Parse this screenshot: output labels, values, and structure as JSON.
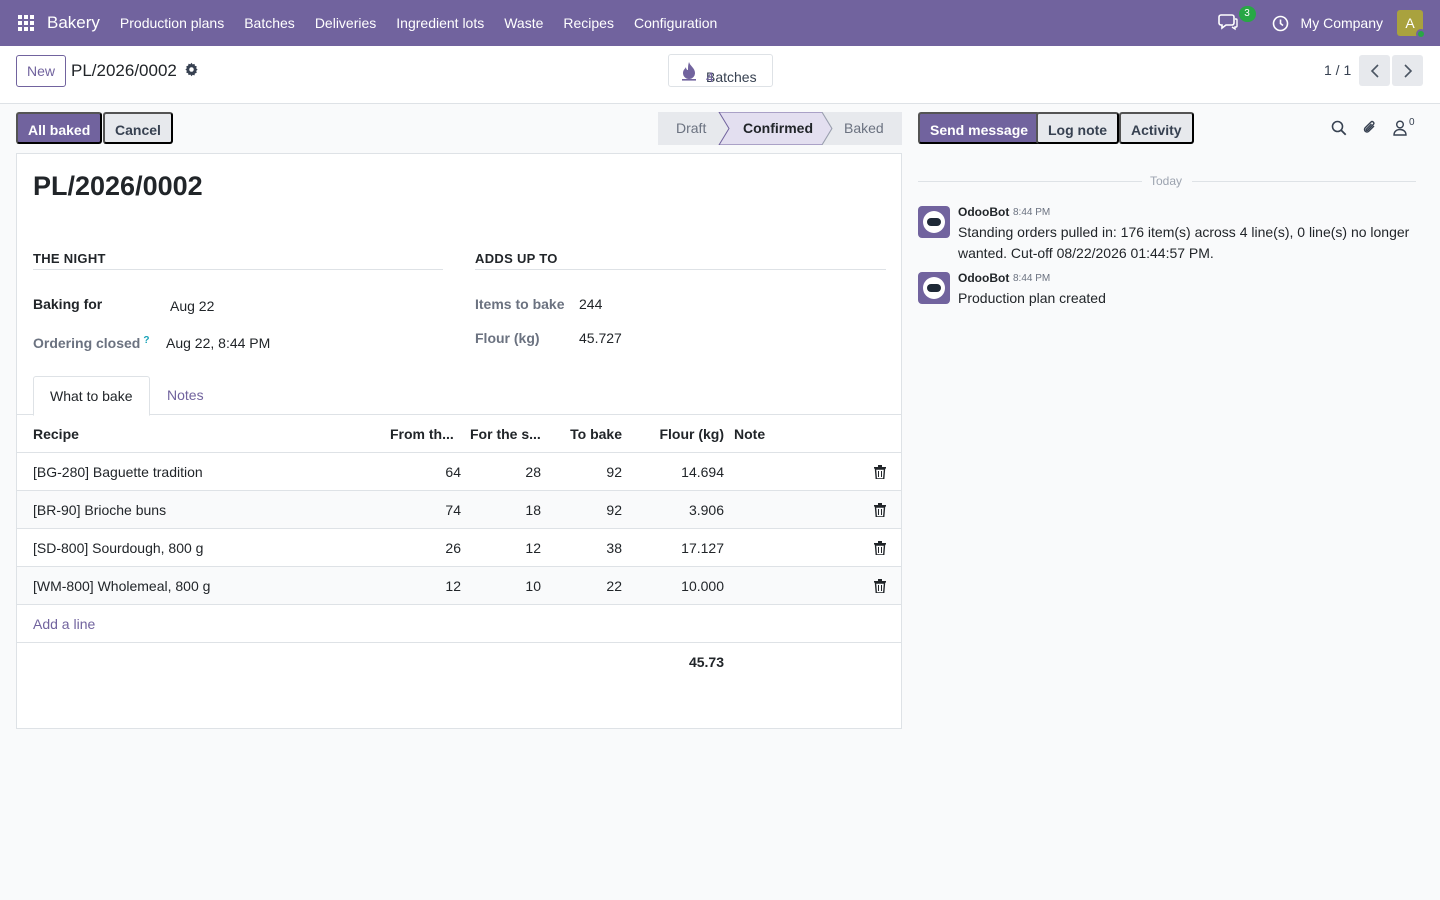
{
  "navbar": {
    "brand": "Bakery",
    "menu": [
      "Production plans",
      "Batches",
      "Deliveries",
      "Ingredient lots",
      "Waste",
      "Recipes",
      "Configuration"
    ],
    "messages_count": "3",
    "company": "My Company",
    "avatar_letter": "A",
    "accent": "#71639e"
  },
  "control": {
    "new_label": "New",
    "record_name": "PL/2026/0002",
    "smart_button": {
      "label": "Batches",
      "value": "4"
    },
    "pager": "1 / 1"
  },
  "actions": {
    "all_baked": "All baked",
    "cancel": "Cancel"
  },
  "statusbar": {
    "stages": [
      "Draft",
      "Confirmed",
      "Baked"
    ],
    "current": "Confirmed"
  },
  "form": {
    "title": "PL/2026/0002",
    "group_left": {
      "title": "THE NIGHT",
      "baking_for_label": "Baking for",
      "baking_for_value": "Aug 22",
      "ordering_closed_label": "Ordering closed",
      "help_mark": "?",
      "ordering_closed_value": "Aug 22, 8:44 PM"
    },
    "group_right": {
      "title": "ADDS UP TO",
      "items_label": "Items to bake",
      "items_value": "244",
      "flour_label": "Flour (kg)",
      "flour_value": "45.727"
    },
    "tabs": [
      "What to bake",
      "Notes"
    ],
    "table": {
      "headers": [
        "Recipe",
        "From th...",
        "For the s...",
        "To bake",
        "Flour (kg)",
        "Note"
      ],
      "rows": [
        {
          "recipe": "[BG-280] Baguette tradition",
          "from": "64",
          "for": "28",
          "to_bake": "92",
          "flour": "14.694",
          "note": ""
        },
        {
          "recipe": "[BR-90] Brioche buns",
          "from": "74",
          "for": "18",
          "to_bake": "92",
          "flour": "3.906",
          "note": ""
        },
        {
          "recipe": "[SD-800] Sourdough, 800 g",
          "from": "26",
          "for": "12",
          "to_bake": "38",
          "flour": "17.127",
          "note": ""
        },
        {
          "recipe": "[WM-800] Wholemeal, 800 g",
          "from": "12",
          "for": "10",
          "to_bake": "22",
          "flour": "10.000",
          "note": ""
        }
      ],
      "add_line": "Add a line",
      "total_flour": "45.73"
    }
  },
  "chatter": {
    "send_message": "Send message",
    "log_note": "Log note",
    "activity": "Activity",
    "followers_count": "0",
    "date_separator": "Today",
    "messages": [
      {
        "author": "OdooBot",
        "time": "8:44 PM",
        "body": "Standing orders pulled in: 176 item(s) across 4 line(s), 0 line(s) no longer wanted. Cut-off 08/22/2026 01:44:57 PM."
      },
      {
        "author": "OdooBot",
        "time": "8:44 PM",
        "body": "Production plan created"
      }
    ]
  }
}
